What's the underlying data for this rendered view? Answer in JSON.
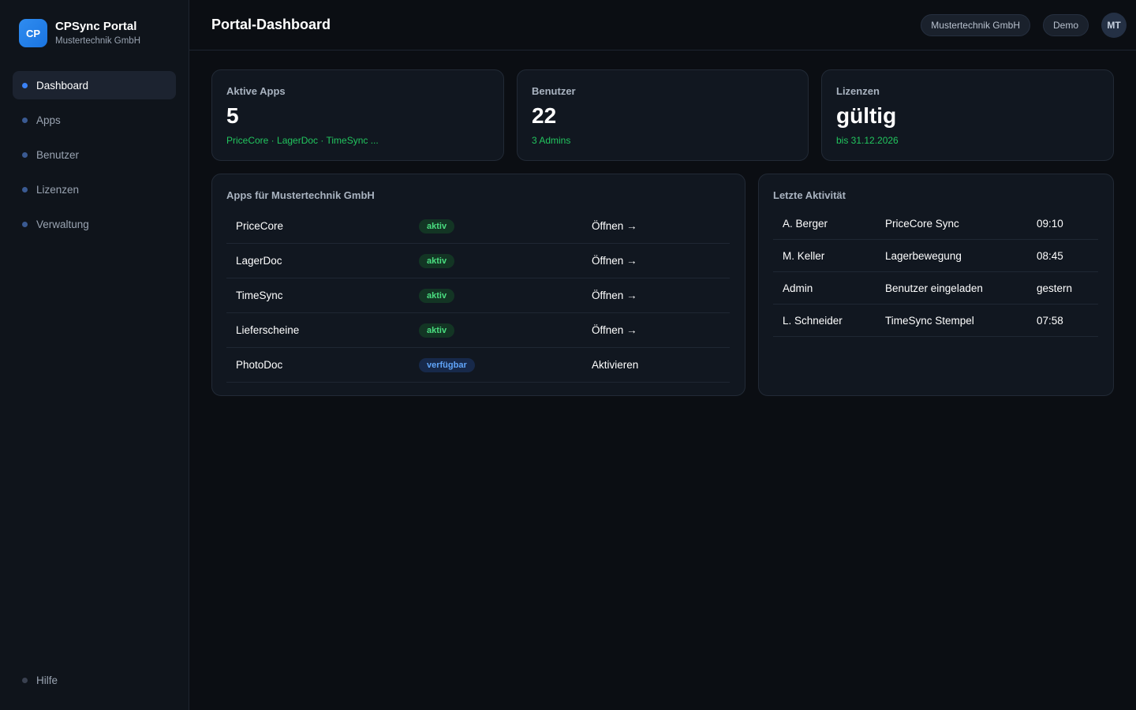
{
  "brand": {
    "logo_text": "CP",
    "title": "CPSync Portal",
    "subtitle": "Mustertechnik GmbH",
    "logo_color": "#2f8cf0"
  },
  "nav": {
    "items": [
      {
        "label": "Dashboard",
        "active": true
      },
      {
        "label": "Apps",
        "active": false
      },
      {
        "label": "Benutzer",
        "active": false
      },
      {
        "label": "Lizenzen",
        "active": false
      },
      {
        "label": "Verwaltung",
        "active": false
      }
    ],
    "help_label": "Hilfe"
  },
  "header": {
    "title": "Portal-Dashboard",
    "company_pill": "Mustertechnik GmbH",
    "mode_pill": "Demo",
    "avatar_initials": "MT"
  },
  "stats": [
    {
      "label": "Aktive Apps",
      "value": "5",
      "sub": "PriceCore · LagerDoc · TimeSync ..."
    },
    {
      "label": "Benutzer",
      "value": "22",
      "sub": "3 Admins"
    },
    {
      "label": "Lizenzen",
      "value": "gültig",
      "sub": "bis 31.12.2026"
    }
  ],
  "apps_panel": {
    "title": "Apps für Mustertechnik GmbH",
    "rows": [
      {
        "name": "PriceCore",
        "status": "aktiv",
        "action": "Öffnen →"
      },
      {
        "name": "LagerDoc",
        "status": "aktiv",
        "action": "Öffnen →"
      },
      {
        "name": "TimeSync",
        "status": "aktiv",
        "action": "Öffnen →"
      },
      {
        "name": "Lieferscheine",
        "status": "aktiv",
        "action": "Öffnen →"
      },
      {
        "name": "PhotoDoc",
        "status": "verfügbar",
        "action": "Aktivieren"
      }
    ]
  },
  "activity_panel": {
    "title": "Letzte Aktivität",
    "rows": [
      {
        "user": "A. Berger",
        "event": "PriceCore Sync",
        "time": "09:10"
      },
      {
        "user": "M. Keller",
        "event": "Lagerbewegung",
        "time": "08:45"
      },
      {
        "user": "Admin",
        "event": "Benutzer eingeladen",
        "time": "gestern"
      },
      {
        "user": "L. Schneider",
        "event": "TimeSync Stempel",
        "time": "07:58"
      }
    ]
  },
  "colors": {
    "accent": "#3b82f6",
    "success": "#22c55e",
    "background": "#0b0e13"
  }
}
